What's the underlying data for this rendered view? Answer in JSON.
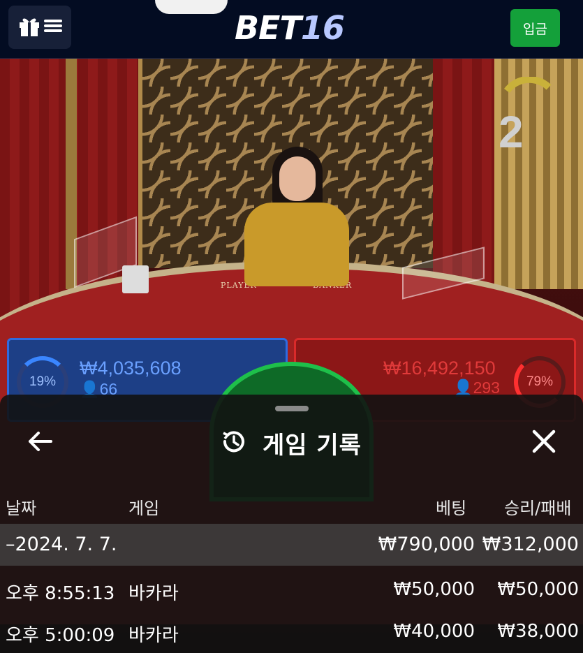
{
  "header": {
    "logo_part1": "BET",
    "logo_part2": "16",
    "deposit_label": "입금",
    "gift_icon": "gift-icon",
    "menu_icon": "hamburger-icon"
  },
  "scene": {
    "round_number": "2",
    "table_player": "PLAYER",
    "table_banker": "BANKER",
    "player": {
      "percent": "19%",
      "amount": "₩4,035,608",
      "count": "66"
    },
    "banker": {
      "percent": "79%",
      "amount": "₩16,492,150",
      "count": "293"
    }
  },
  "sheet": {
    "title": "게임 기록",
    "history_icon": "history-icon",
    "back_icon": "arrow-left-icon",
    "close_icon": "close-icon",
    "columns": {
      "date": "날짜",
      "game": "게임",
      "bet": "베팅",
      "winloss": "승리/패배"
    },
    "group": {
      "date": "2024. 7. 7.",
      "bet_total": "₩790,000",
      "winloss_total": "₩312,000"
    },
    "rows": [
      {
        "time": "오후 8:55:13",
        "game": "바카라",
        "bet": "₩50,000",
        "winloss": "₩50,000"
      },
      {
        "time": "오후 5:00:09",
        "game": "바카라",
        "bet": "₩40,000",
        "winloss": "₩38,000"
      }
    ]
  },
  "colors": {
    "header_bg": "#030c22",
    "deposit_green": "#14a03a",
    "player_blue": "#3a86ff",
    "banker_red": "#e03a3a"
  }
}
